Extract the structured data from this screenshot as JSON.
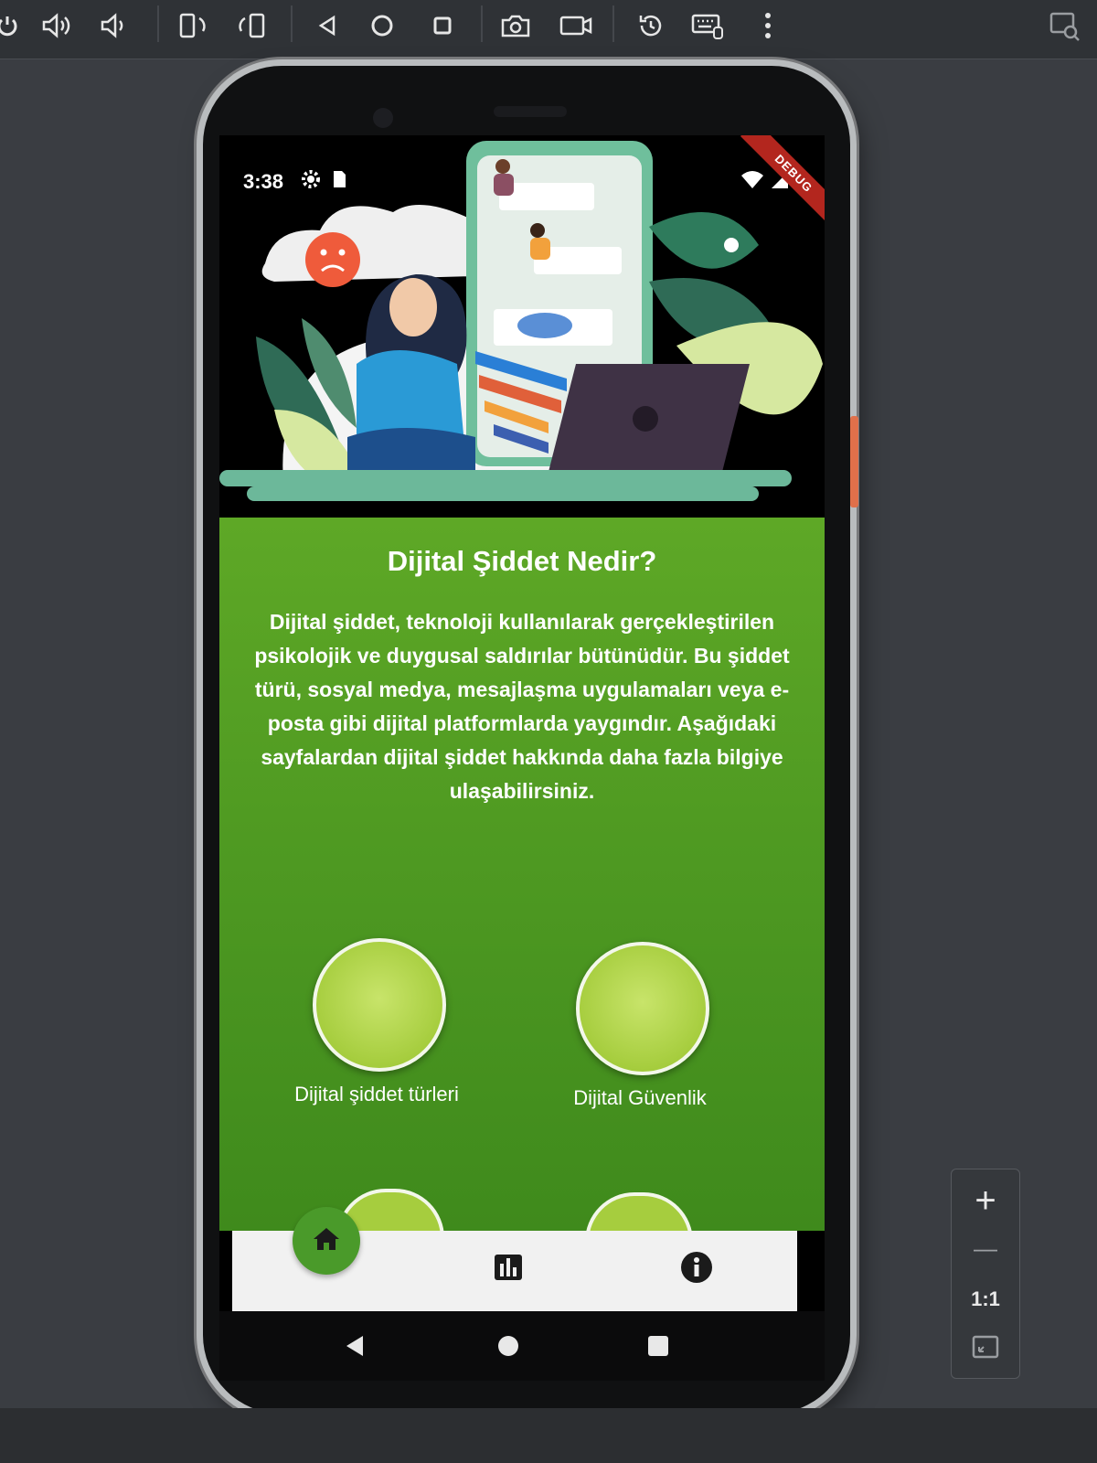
{
  "emulator": {
    "toolbar_icons": [
      "power-icon",
      "volume-up-icon",
      "volume-down-icon",
      "rotate-left-icon",
      "rotate-right-icon",
      "back-icon",
      "home-icon",
      "overview-icon",
      "camera-icon",
      "screenrecord-icon",
      "snapshot-icon",
      "keyboard-icon",
      "more-icon"
    ],
    "zoom": {
      "plus": "+",
      "minus": "—",
      "ratio": "1:1"
    }
  },
  "phone": {
    "status": {
      "time": "3:38",
      "debug": "DEBUG"
    },
    "page": {
      "title": "Dijital Şiddet Nedir?",
      "description": "Dijital şiddet, teknoloji kullanılarak gerçekleştirilen psikolojik ve duygusal saldırılar bütünüdür. Bu şiddet türü, sosyal medya, mesajlaşma uygulamaları veya e-posta gibi dijital platformlarda yaygındır. Aşağıdaki sayfalardan dijital şiddet hakkında daha fazla bilgiye ulaşabilirsiniz.",
      "cards": [
        {
          "label": "Dijital şiddet türleri"
        },
        {
          "label": "Dijital Güvenlik"
        }
      ]
    },
    "bottom_nav": [
      "home-icon",
      "chart-icon",
      "info-icon"
    ],
    "colors": {
      "panel": "#4f9a22",
      "circle": "#a6cd3e",
      "accent": "#4a9a2a"
    }
  }
}
